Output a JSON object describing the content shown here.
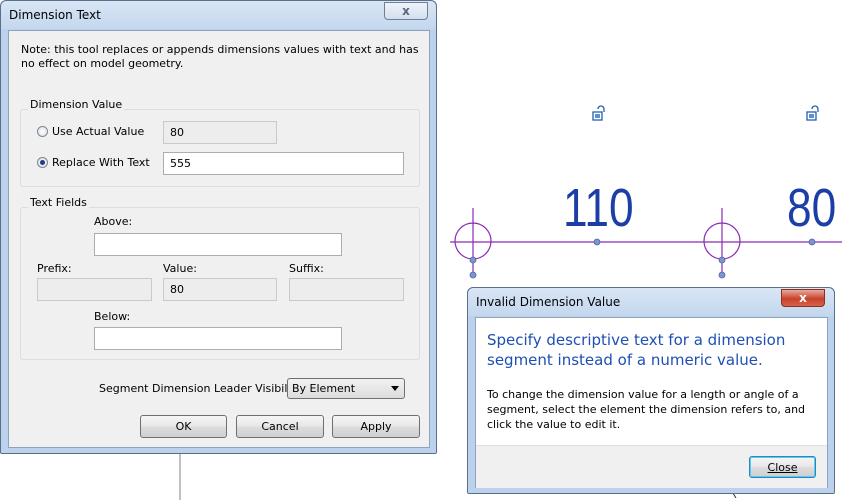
{
  "canvas": {
    "dimension_values": [
      "110",
      "80"
    ],
    "colors": {
      "dimension_text": "#1b3fa6",
      "dimension_line": "#8a2ab8",
      "grid_bubble": "#8a2ab8"
    },
    "icons": [
      "lock-icon",
      "lock-icon"
    ]
  },
  "dimension_dialog": {
    "title": "Dimension Text",
    "close_glyph": "x",
    "note": "Note: this tool replaces or appends dimensions values with text and has no effect on model geometry.",
    "dimension_value": {
      "group_title": "Dimension Value",
      "use_actual_label": "Use Actual Value",
      "actual_value": "80",
      "replace_label": "Replace With Text",
      "replace_value": "555",
      "selected": "replace"
    },
    "text_fields": {
      "group_title": "Text Fields",
      "above_label": "Above:",
      "above_value": "",
      "prefix_label": "Prefix:",
      "prefix_value": "",
      "value_label": "Value:",
      "value_value": "80",
      "suffix_label": "Suffix:",
      "suffix_value": "",
      "below_label": "Below:",
      "below_value": ""
    },
    "leader_visibility_label": "Segment Dimension Leader Visibility:",
    "leader_visibility_value": "By Element",
    "buttons": {
      "ok": "OK",
      "cancel": "Cancel",
      "apply": "Apply"
    }
  },
  "invalid_dialog": {
    "title": "Invalid Dimension Value",
    "close_glyph": "x",
    "instruction": "Specify descriptive text for a dimension segment instead of a numeric value.",
    "content": "To change the dimension value for a length or angle of a segment, select the element the dimension refers to, and click the value to edit it.",
    "close_button": "Close"
  }
}
